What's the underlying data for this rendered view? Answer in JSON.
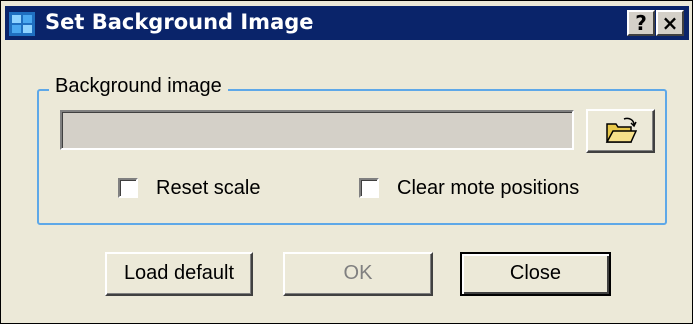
{
  "window": {
    "title": "Set Background Image",
    "help_label": "?",
    "close_label": "×",
    "colors": {
      "titlebar": "#0a246a",
      "face": "#ece9d8",
      "groupbox_border": "#5ea8e8",
      "disabled_text": "#808080"
    }
  },
  "group": {
    "legend": "Background image",
    "path_value": "",
    "browse_icon": "open-folder-icon"
  },
  "options": {
    "reset_scale": {
      "label": "Reset scale",
      "checked": false
    },
    "clear_mote": {
      "label": "Clear mote positions",
      "checked": false
    }
  },
  "buttons": {
    "load_default": "Load default",
    "ok": "OK",
    "close": "Close"
  }
}
